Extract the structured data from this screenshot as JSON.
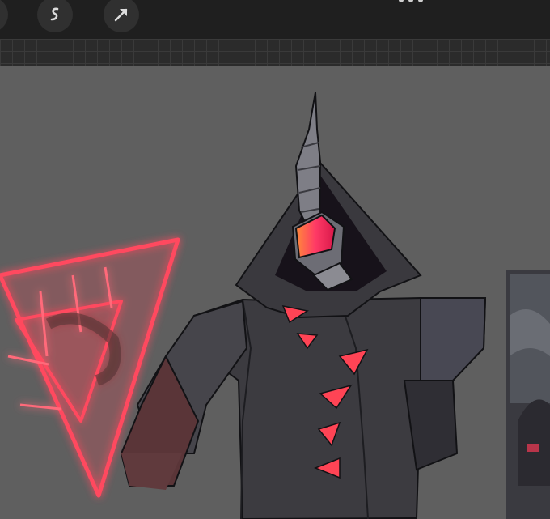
{
  "toolbar": {
    "tools": [
      {
        "icon": "brush-icon",
        "state": "partially visible"
      },
      {
        "icon": "smudge-icon"
      },
      {
        "icon": "transform-arrow-icon"
      }
    ],
    "more_menu_icon": "more-dots-icon"
  },
  "canvas": {
    "background_color": "#5f5f5f",
    "artwork": "hooded-horned-character-with-glowing-red-triangle",
    "accent_color": "#ff3a55"
  }
}
